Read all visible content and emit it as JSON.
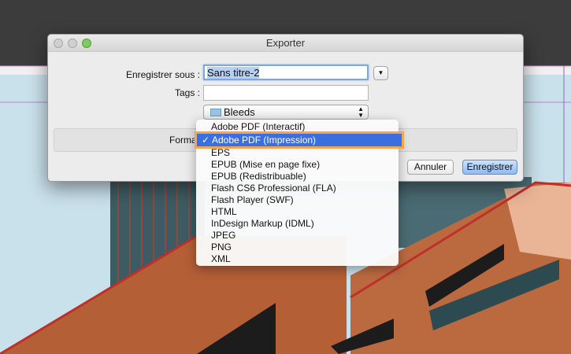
{
  "dialog": {
    "title": "Exporter",
    "save_as_label": "Enregistrer sous :",
    "save_as_value": "Sans titre-2",
    "tags_label": "Tags :",
    "tags_value": "",
    "location": "Bleeds",
    "format_label": "Format",
    "cancel_label": "Annuler",
    "save_label": "Enregistrer"
  },
  "format_menu": {
    "selected": "Adobe PDF (Impression)",
    "check": "✓",
    "items": [
      "Adobe PDF (Interactif)",
      "Adobe PDF (Impression)",
      "EPS",
      "EPUB (Mise en page fixe)",
      "EPUB (Redistribuable)",
      "Flash CS6 Professional (FLA)",
      "Flash Player (SWF)",
      "HTML",
      "InDesign Markup (IDML)",
      "JPEG",
      "PNG",
      "XML"
    ]
  },
  "colors": {
    "highlight": "#3a6fe0",
    "callout": "#f7a44a",
    "primary_button": "#8fbaf2"
  }
}
